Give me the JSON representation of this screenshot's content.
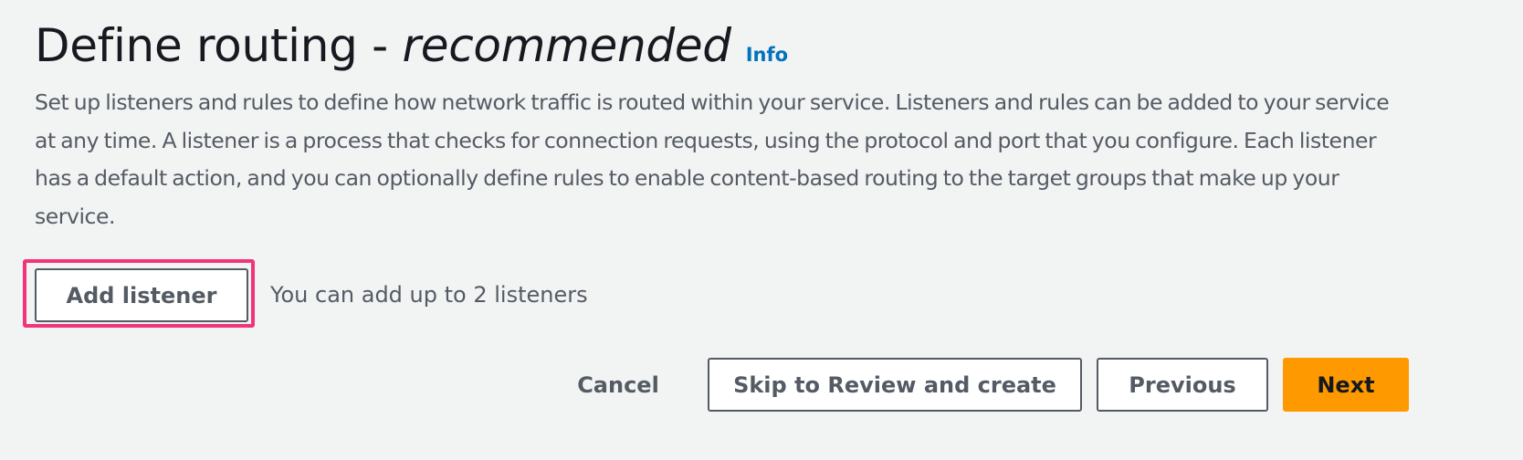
{
  "header": {
    "title_main": "Define routing",
    "title_separator": " - ",
    "title_emphasis": "recommended",
    "info_link": "Info"
  },
  "description": "Set up listeners and rules to define how network traffic is routed within your service. Listeners and rules can be added to your service at any time. A listener is a process that checks for connection requests, using the protocol and port that you configure. Each listener has a default action, and you can optionally define rules to enable content-based routing to the target groups that make up your service.",
  "listeners": {
    "add_button_label": "Add listener",
    "limit_hint": "You can add up to 2 listeners"
  },
  "footer": {
    "cancel_label": "Cancel",
    "skip_label": "Skip to Review and create",
    "previous_label": "Previous",
    "next_label": "Next"
  },
  "colors": {
    "background": "#f2f3f3",
    "primary_button": "#ff9900",
    "link": "#0073bb",
    "highlight": "#f2357a"
  }
}
